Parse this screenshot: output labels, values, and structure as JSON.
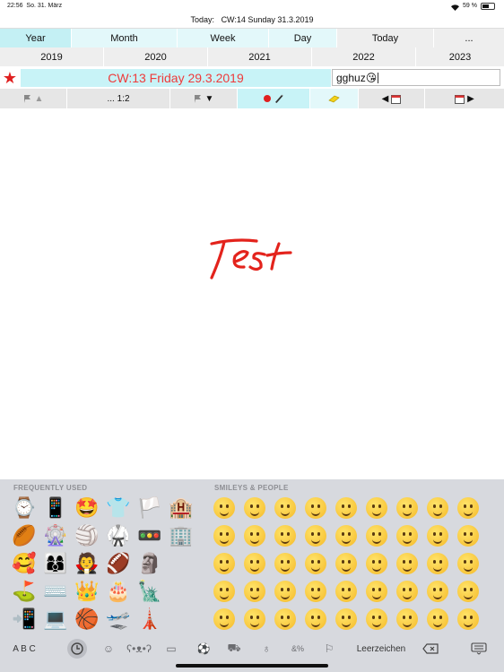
{
  "status": {
    "time": "22:56",
    "date": "So. 31. März",
    "battery": "59 %",
    "battery_level": 0.59
  },
  "today_bar": {
    "label": "Today:",
    "value": "CW:14 Sunday 31.3.2019"
  },
  "tabs": [
    {
      "label": "Year",
      "active": true
    },
    {
      "label": "Month"
    },
    {
      "label": "Week"
    },
    {
      "label": "Day"
    },
    {
      "label": "Today"
    },
    {
      "label": "..."
    }
  ],
  "years": [
    "2019",
    "2020",
    "2021",
    "2022",
    "2023"
  ],
  "date_bar": {
    "text": "CW:13 Friday 29.3.2019"
  },
  "note_field": {
    "value": "gghuz😘"
  },
  "tools": [
    {
      "label": "▲",
      "icon": "flag-up-icon"
    },
    {
      "label": "...  1:2",
      "icon": "flag-ratio-icon"
    },
    {
      "label": "▼",
      "icon": "flag-down-icon"
    },
    {
      "label": "",
      "icon": "pen-color-icon"
    },
    {
      "label": "",
      "icon": "eraser-icon"
    },
    {
      "label": "◀",
      "icon": "calendar-prev-icon"
    },
    {
      "label": "▶",
      "icon": "calendar-next-icon"
    }
  ],
  "canvas": {
    "handwriting": "Test",
    "ink_color": "#e3231c"
  },
  "keyboard": {
    "frequent_header": "FREQUENTLY USED",
    "smileys_header": "SMILEYS & PEOPLE",
    "frequent": [
      "⌚",
      "📱",
      "🤩",
      "👕",
      "🏳️",
      "🏨",
      "🏉",
      "🎡",
      "🏐",
      "🥋",
      "🚥",
      "🏢",
      "🥰",
      "👩‍👩‍👦",
      "🧛",
      "🏈",
      "🗿",
      "",
      "⛳",
      "⌨️",
      "👑",
      "🎂",
      "🗽",
      "",
      "📲",
      "💻",
      "🏀",
      "🛫",
      "🗼",
      ""
    ],
    "abc": "A B C",
    "space": "Leerzeichen",
    "categories": [
      "clock-icon",
      "smiley-icon",
      "bear-icon",
      "burger-icon",
      "ball-icon",
      "car-icon",
      "bulb-icon",
      "symbols-icon",
      "flag-icon"
    ]
  }
}
